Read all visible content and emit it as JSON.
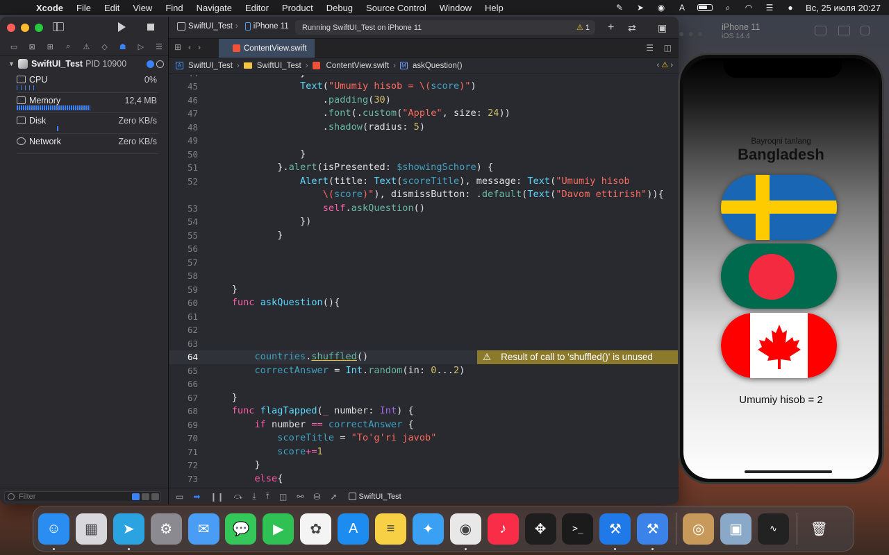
{
  "menubar": {
    "app": "Xcode",
    "items": [
      "File",
      "Edit",
      "View",
      "Find",
      "Navigate",
      "Editor",
      "Product",
      "Debug",
      "Source Control",
      "Window",
      "Help"
    ],
    "clock": "Вс, 25 июля  20:27",
    "status_icons": [
      "pen-icon",
      "telegram-icon",
      "play-circle-icon",
      "keyboard-A-icon",
      "battery-icon",
      "search-icon",
      "wifi-icon",
      "control-center-icon",
      "siri-icon"
    ]
  },
  "navigator": {
    "process_name": "SwiftUI_Test",
    "pid": "PID 10900",
    "gauges": [
      {
        "label": "CPU",
        "value": "0%"
      },
      {
        "label": "Memory",
        "value": "12,4 MB",
        "fill": 0.5
      },
      {
        "label": "Disk",
        "value": "Zero KB/s"
      },
      {
        "label": "Network",
        "value": "Zero KB/s"
      }
    ],
    "filter_placeholder": "Filter"
  },
  "toolbar": {
    "scheme": "SwiftUI_Test",
    "device": "iPhone 11",
    "activity": "Running SwiftUI_Test on iPhone 11",
    "warning_count": "1"
  },
  "tab": {
    "file": "ContentView.swift"
  },
  "jumpbar": {
    "items": [
      "SwiftUI_Test",
      "SwiftUI_Test",
      "ContentView.swift",
      "askQuestion()"
    ]
  },
  "issue": {
    "line": 64,
    "message": "Result of call to 'shuffled()' is unused"
  },
  "debugbar": {
    "target": "SwiftUI_Test"
  },
  "simulator": {
    "device": "iPhone 11",
    "os": "iOS 14.4",
    "prompt": "Bayroqni tanlang",
    "country": "Bangladesh",
    "flags": [
      "Sweden",
      "Bangladesh",
      "Canada"
    ],
    "score_text": "Umumiy hisob = 2"
  },
  "dock": {
    "apps": [
      {
        "name": "finder",
        "color": "#2a8df2",
        "glyph": "☺",
        "running": true
      },
      {
        "name": "launchpad",
        "color": "#d8d8dc",
        "glyph": "▦",
        "running": false
      },
      {
        "name": "telegram",
        "color": "#2aa3e0",
        "glyph": "➤",
        "running": true
      },
      {
        "name": "system-preferences",
        "color": "#8a8a90",
        "glyph": "⚙",
        "running": false
      },
      {
        "name": "mail",
        "color": "#4a9df5",
        "glyph": "✉",
        "running": false
      },
      {
        "name": "messages",
        "color": "#34c759",
        "glyph": "💬",
        "running": false
      },
      {
        "name": "facetime",
        "color": "#2fc153",
        "glyph": "▶",
        "running": false
      },
      {
        "name": "photos",
        "color": "#f4f4f4",
        "glyph": "✿",
        "running": false
      },
      {
        "name": "app-store",
        "color": "#1d8cf0",
        "glyph": "A",
        "running": false
      },
      {
        "name": "notes",
        "color": "#f7d046",
        "glyph": "≡",
        "running": false
      },
      {
        "name": "safari",
        "color": "#3aa0f3",
        "glyph": "✦",
        "running": false
      },
      {
        "name": "chrome",
        "color": "#e8e8e8",
        "glyph": "◉",
        "running": true
      },
      {
        "name": "music",
        "color": "#fa2d48",
        "glyph": "♪",
        "running": false
      },
      {
        "name": "figma",
        "color": "#1e1e1e",
        "glyph": "✥",
        "running": false
      },
      {
        "name": "terminal",
        "color": "#1b1b1b",
        "glyph": ">_",
        "running": false
      },
      {
        "name": "xcode",
        "color": "#2079e8",
        "glyph": "⚒",
        "running": true
      },
      {
        "name": "instruments",
        "color": "#3b83e8",
        "glyph": "⚒",
        "running": true
      },
      {
        "name": "separator"
      },
      {
        "name": "contacts",
        "color": "#c79a5c",
        "glyph": "◎",
        "running": false
      },
      {
        "name": "preview",
        "color": "#8aa8c8",
        "glyph": "▣",
        "running": false
      },
      {
        "name": "activity-monitor",
        "color": "#222",
        "glyph": "∿",
        "running": false
      },
      {
        "name": "separator"
      },
      {
        "name": "trash",
        "color": "transparent",
        "glyph": "🗑",
        "running": false
      }
    ]
  }
}
